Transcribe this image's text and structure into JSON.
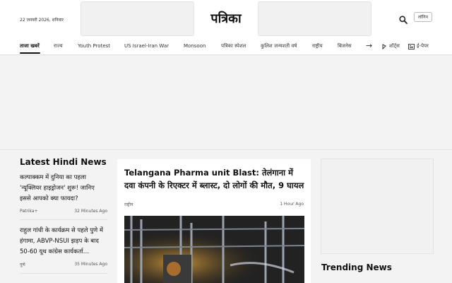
{
  "header": {
    "date": "22 जनवरी 2026, शनिवार",
    "logo_text": "पत्रिका",
    "login_label": "लॉगिन",
    "search_icon": "search-icon"
  },
  "nav": {
    "items": [
      {
        "label": "ताजा खबरें",
        "active": true
      },
      {
        "label": "राज्य"
      },
      {
        "label": "Youth Protest"
      },
      {
        "label": "US Israel-Iran War"
      },
      {
        "label": "Monsoon"
      },
      {
        "label": "पत्रिका स्पेशल"
      },
      {
        "label": "कुलिश जन्मशती वर्ष"
      },
      {
        "label": "राष्ट्रीय"
      },
      {
        "label": "बिजनेस"
      }
    ],
    "more_icon": "arrow-right-icon",
    "shorts_label": "शॉर्ट्स",
    "epaper_label": "ई-पेपर"
  },
  "latest": {
    "title": "Latest Hindi News",
    "items": [
      {
        "headline": "कल्पाक्कम में दुनिया का पहला 'न्यूक्लियर हाइड्रोजन' शुरू! जानिए इससे आपको क्या फायदा?",
        "source": "Patrika+",
        "time": "32 Minutes Ago"
      },
      {
        "headline": "राहुल गांधी के कार्यक्रम से पहले पुणे में हंगामा, ABVP-NSUI झड़प के बाद 50-60 यूथ कांग्रेस कार्यकर्ता…",
        "source": "पुणे",
        "time": "35 Minutes Ago"
      }
    ]
  },
  "feature": {
    "title": "Telangana Pharma unit Blast: तेलंगाना में दवा कंपनी के रिएक्टर में ब्लास्ट, दो लोगों की मौत, 9 घायल",
    "category": "राष्ट्रीय",
    "time": "1 Hour Ago"
  },
  "trending": {
    "title": "Trending News"
  }
}
